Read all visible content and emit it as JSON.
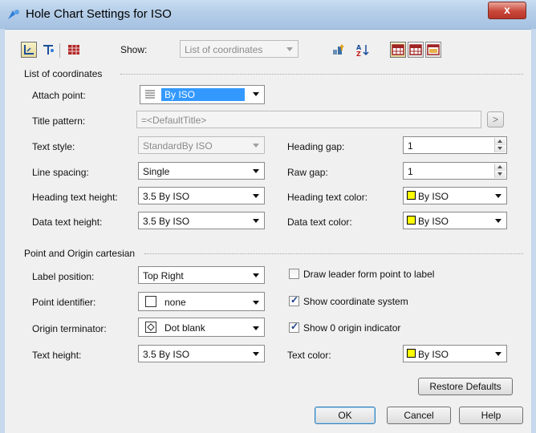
{
  "window": {
    "title": "Hole Chart Settings for ISO",
    "close_label": "x"
  },
  "toolbar": {
    "show_label": "Show:",
    "show_value": "List of coordinates",
    "icons": [
      "coordinate-table-icon",
      "hole-table-icon",
      "grid-table-icon",
      "sort-icon",
      "sort-az-icon",
      "table-layout-1-icon",
      "table-layout-2-icon",
      "table-layout-3-icon"
    ]
  },
  "list_of_coordinates": {
    "group_label": "List of coordinates",
    "attach_point_label": "Attach point:",
    "attach_point_value": "By ISO",
    "title_pattern_label": "Title pattern:",
    "title_pattern_value": "=<DefaultTitle>",
    "title_pattern_button": ">",
    "text_style_label": "Text style:",
    "text_style_value": "StandardBy ISO",
    "heading_gap_label": "Heading gap:",
    "heading_gap_value": "1",
    "line_spacing_label": "Line spacing:",
    "line_spacing_value": "Single",
    "raw_gap_label": "Raw gap:",
    "raw_gap_value": "1",
    "heading_text_height_label": "Heading text height:",
    "heading_text_height_value": "3.5 By ISO",
    "heading_text_color_label": "Heading text color:",
    "heading_text_color_value": "By ISO",
    "data_text_height_label": "Data text height:",
    "data_text_height_value": "3.5 By ISO",
    "data_text_color_label": "Data text color:",
    "data_text_color_value": "By ISO"
  },
  "point_origin": {
    "group_label": "Point and Origin cartesian",
    "label_position_label": "Label position:",
    "label_position_value": "Top Right",
    "draw_leader_label": "Draw leader form point to label",
    "draw_leader_checked": false,
    "point_identifier_label": "Point identifier:",
    "point_identifier_value": "none",
    "show_coordinate_system_label": "Show coordinate system",
    "show_coordinate_system_checked": true,
    "origin_terminator_label": "Origin terminator:",
    "origin_terminator_value": "Dot blank",
    "show_origin_indicator_label": "Show 0 origin indicator",
    "show_origin_indicator_checked": true,
    "text_height_label": "Text height:",
    "text_height_value": "3.5 By ISO",
    "text_color_label": "Text color:",
    "text_color_value": "By ISO"
  },
  "buttons": {
    "restore_defaults": "Restore Defaults",
    "ok": "OK",
    "cancel": "Cancel",
    "help": "Help"
  },
  "colors": {
    "swatch_yellow": "#ffff00",
    "selection_blue": "#3399ff",
    "titlebar": "#b4cde8"
  }
}
